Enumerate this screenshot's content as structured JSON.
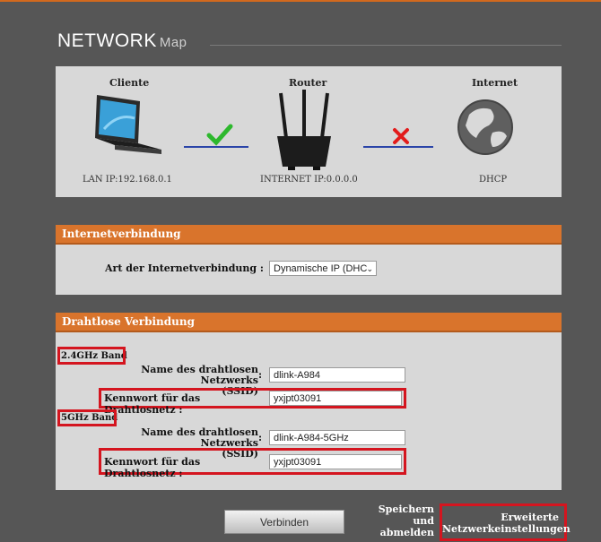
{
  "header": {
    "title_main": "NETWORK",
    "title_sub": "Map"
  },
  "network_map": {
    "client": {
      "heading": "Cliente",
      "caption": "LAN IP:192.168.0.1"
    },
    "router": {
      "heading": "Router",
      "caption": "INTERNET IP:0.0.0.0"
    },
    "internet": {
      "heading": "Internet",
      "caption": "DHCP"
    },
    "client_router_status": "connected",
    "router_internet_status": "disconnected"
  },
  "internet_connection": {
    "heading": "Internetverbindung",
    "type_label": "Art der Internetverbindung :",
    "type_value": "Dynamische IP (DHC"
  },
  "wireless": {
    "heading": "Drahtlose Verbindung",
    "band_24": {
      "band_label": "2.4GHz Band",
      "ssid_label_line1": "Name des drahtlosen Netzwerks",
      "ssid_label_line2": "(SSID)",
      "ssid_value": "dlink-A984",
      "password_label": "Kennwort für das Drahtlosnetz :",
      "password_value": "yxjpt03091"
    },
    "band_5": {
      "band_label": "5GHz Band",
      "ssid_label_line1": "Name des drahtlosen Netzwerks",
      "ssid_label_line2": "(SSID)",
      "ssid_value": "dlink-A984-5GHz",
      "password_label": "Kennwort für das Drahtlosnetz :",
      "password_value": "yxjpt03091"
    }
  },
  "footer": {
    "connect_label": "Verbinden",
    "save_logout_line1": "Speichern",
    "save_logout_line2": "und",
    "save_logout_line3": "abmelden",
    "advanced_line1": "Erweiterte",
    "advanced_line2": "Netzwerkeinstellungen"
  },
  "colors": {
    "accent": "#d9742c",
    "highlight": "#d4151f",
    "ok": "#2db82d",
    "error": "#e21b1b",
    "link_line": "#2a44a8"
  }
}
